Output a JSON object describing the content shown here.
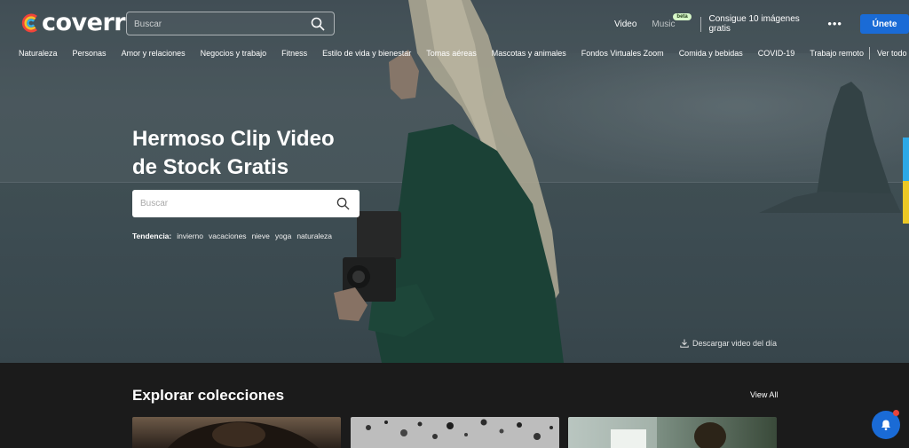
{
  "brand": {
    "name": "coverr"
  },
  "nav": {
    "search_placeholder": "Buscar",
    "video": "Video",
    "music": "Music",
    "music_badge": "beta",
    "promo": "Consigue 10 imágenes gratis",
    "more": "•••",
    "join": "Únete"
  },
  "categories": [
    "Naturaleza",
    "Personas",
    "Amor y relaciones",
    "Negocios y trabajo",
    "Fitness",
    "Estilo de vida y bienestar",
    "Tomas aéreas",
    "Mascotas y animales",
    "Fondos Virtuales Zoom",
    "Comida y bebidas",
    "COVID-19",
    "Trabajo remoto"
  ],
  "categories_see_all": "Ver todo",
  "hero": {
    "title_line1": "Hermoso Clip Video",
    "title_line2": "de Stock Gratis",
    "search_placeholder": "Buscar",
    "trending_label": "Tendencia:",
    "trending": [
      "invierno",
      "vacaciones",
      "nieve",
      "yoga",
      "naturaleza"
    ],
    "download": "Descargar video del día"
  },
  "collections": {
    "title": "Explorar colecciones",
    "view_all": "View All"
  },
  "icons": {
    "search": "search-icon",
    "download": "download-icon",
    "chat": "bell-icon"
  },
  "colors": {
    "primary": "#1a6bd6",
    "beta_badge": "#d7f7c8",
    "accent_blue": "#2da8e6",
    "accent_yellow": "#ecc825",
    "notification": "#e8443a"
  }
}
